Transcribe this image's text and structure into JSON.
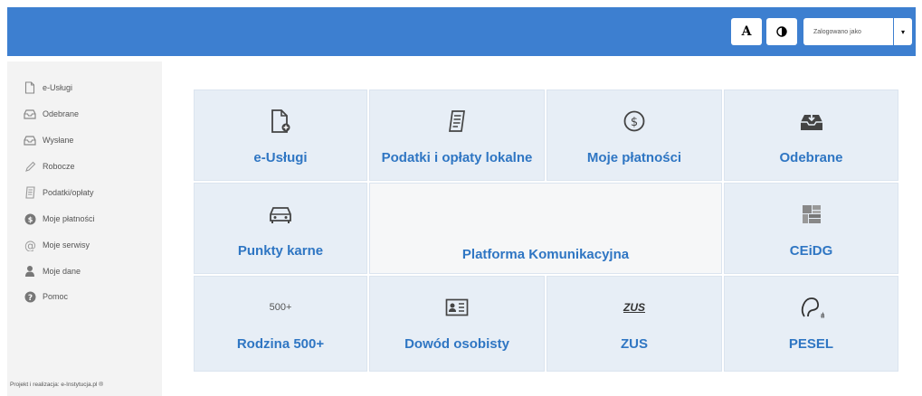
{
  "topbar": {
    "font_button_label": "A",
    "contrast_icon": "contrast-icon",
    "login_label": "Zalogowano jako",
    "menu_caret": "▾",
    "accent_color": "#3d7fd0"
  },
  "sidebar": {
    "items": [
      {
        "label": "e-Usługi",
        "icon": "document-icon"
      },
      {
        "label": "Odebrane",
        "icon": "inbox-icon"
      },
      {
        "label": "Wysłane",
        "icon": "outbox-icon"
      },
      {
        "label": "Robocze",
        "icon": "pencil-icon"
      },
      {
        "label": "Podatki/opłaty",
        "icon": "receipt-icon"
      },
      {
        "label": "Moje płatności",
        "icon": "dollar-icon"
      },
      {
        "label": "Moje serwisy",
        "icon": "at-icon"
      },
      {
        "label": "Moje dane",
        "icon": "user-icon"
      },
      {
        "label": "Pomoc",
        "icon": "help-icon"
      }
    ],
    "footer": "Projekt i realizacja: e-Instytucja.pl ®"
  },
  "tiles": [
    {
      "label": "e-Usługi",
      "icon": "document-add-icon"
    },
    {
      "label": "Podatki i opłaty lokalne",
      "icon": "receipt-icon"
    },
    {
      "label": "Moje płatności",
      "icon": "dollar-circle-icon"
    },
    {
      "label": "Odebrane",
      "icon": "inbox-download-icon"
    },
    {
      "label": "Punkty karne",
      "icon": "car-icon"
    },
    {
      "label": "Platforma Komunikacyjna",
      "icon": ""
    },
    {
      "label": "CEiDG",
      "icon": "ceidg-logo-icon"
    },
    {
      "label": "Rodzina 500+",
      "icon": "500-plus-icon",
      "icon_text": "500+"
    },
    {
      "label": "Dowód osobisty",
      "icon": "id-card-icon"
    },
    {
      "label": "ZUS",
      "icon": "zus-logo-icon",
      "icon_text": "ZUS"
    },
    {
      "label": "PESEL",
      "icon": "pesel-icon",
      "icon_text": "#"
    }
  ]
}
